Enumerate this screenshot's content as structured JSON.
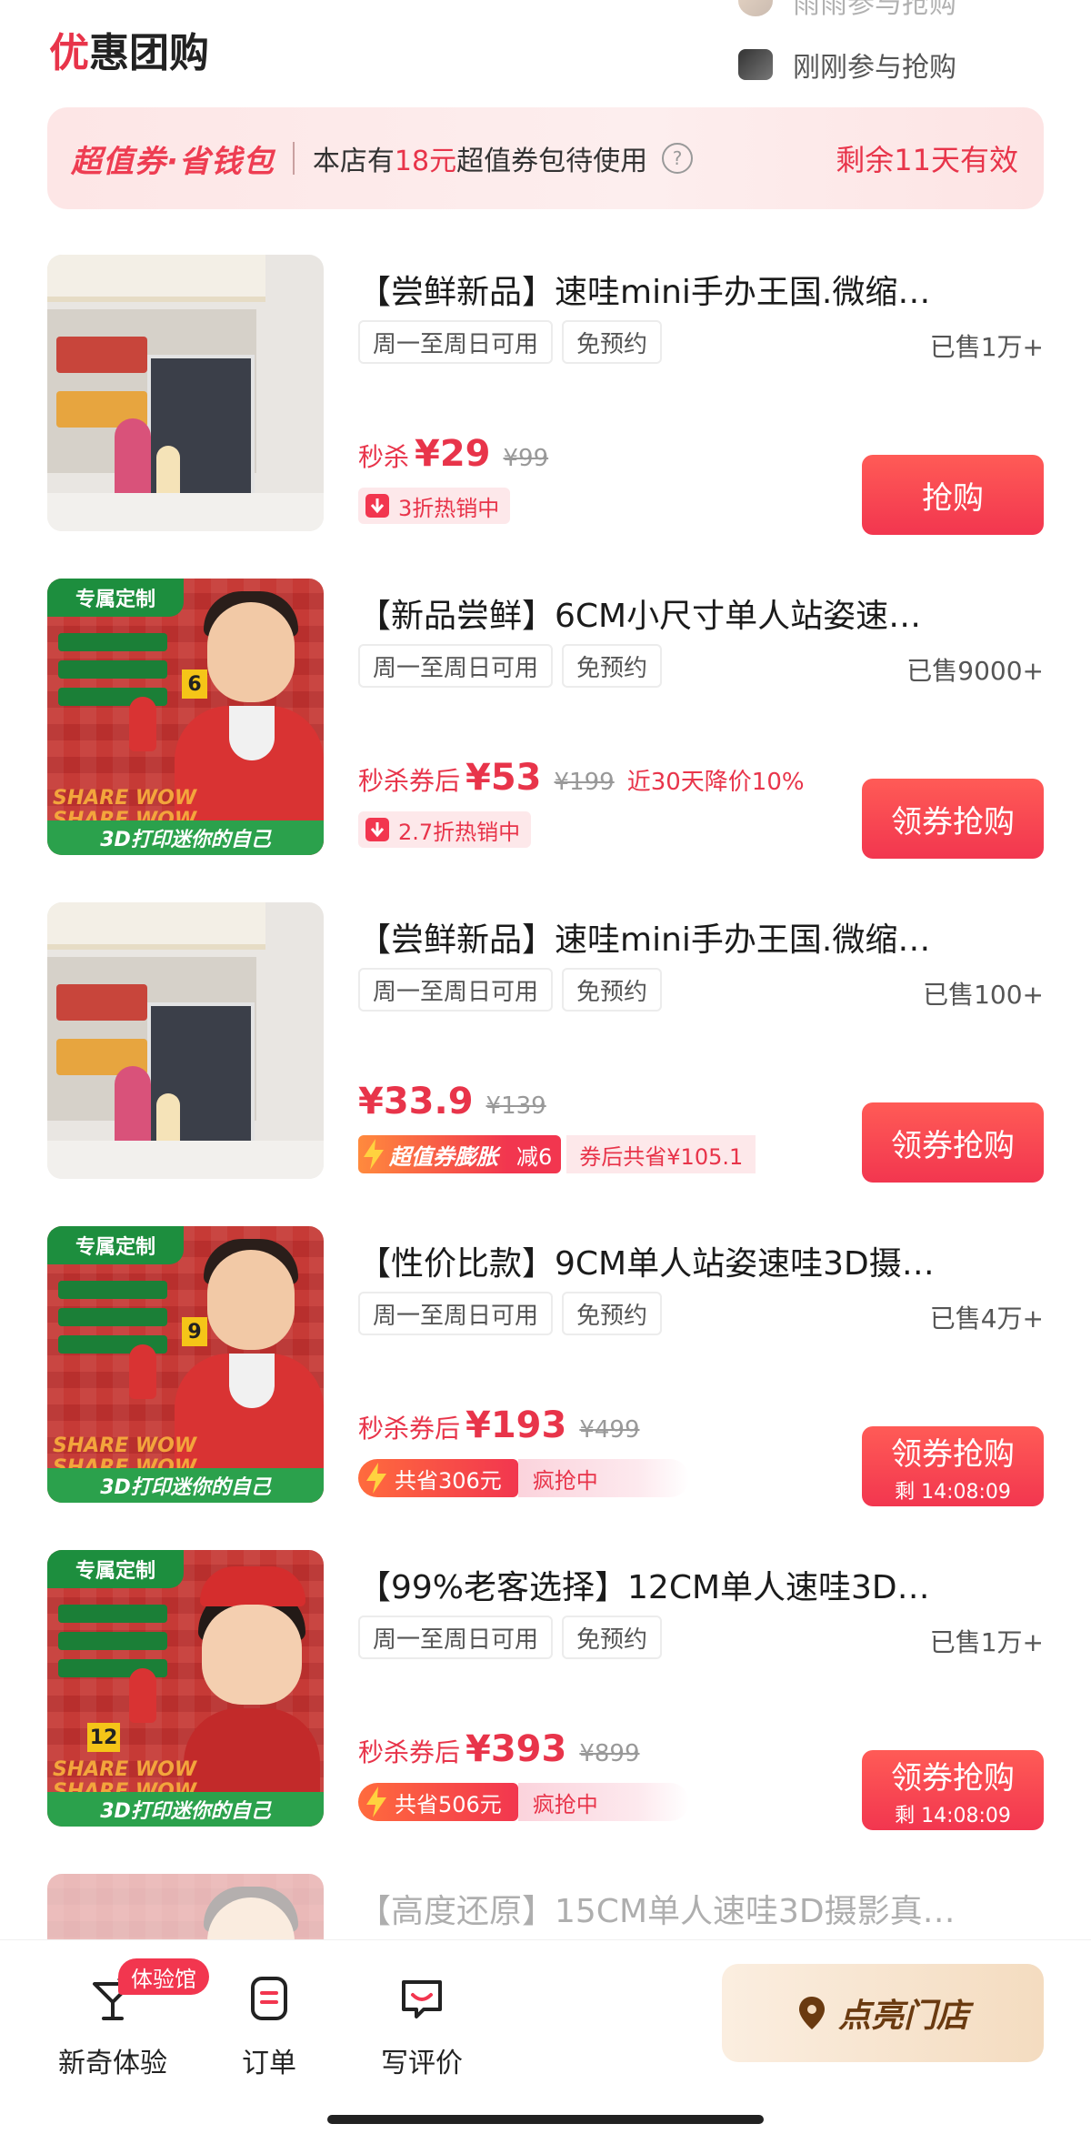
{
  "header": {
    "title_accent": "优",
    "title_rest": "惠团购",
    "rolling_top": "雨雨参与抢购",
    "rolling_live": "刚刚参与抢购"
  },
  "coupon_banner": {
    "brand": "超值券·省钱包",
    "desc_prefix": "本店有",
    "amount": "18元",
    "desc_suffix": "超值券包待使用",
    "expiry": "剩余11天有效"
  },
  "deals": [
    {
      "title": "【尝鲜新品】速哇mini手办王国.微缩…",
      "tags": [
        "周一至周日可用",
        "免预约"
      ],
      "sold": "已售1万+",
      "price_label": "秒杀",
      "price": "¥29",
      "original_price": "¥99",
      "badge": "3折热销中",
      "button": "抢购"
    },
    {
      "title": "【新品尝鲜】6CM小尺寸单人站姿速…",
      "tags": [
        "周一至周日可用",
        "免预约"
      ],
      "sold": "已售9000+",
      "price_label": "秒杀券后",
      "price": "¥53",
      "original_price": "¥199",
      "drop_note": "近30天降价10%",
      "badge": "2.7折热销中",
      "button": "领券抢购",
      "image_tag": "专属定制",
      "image_footer": "3D打印迷你的自己",
      "image_num": "6"
    },
    {
      "title": "【尝鲜新品】速哇mini手办王国.微缩…",
      "tags": [
        "周一至周日可用",
        "免预约"
      ],
      "sold": "已售100+",
      "price": "¥33.9",
      "original_price": "¥139",
      "boost_label": "超值券膨胀",
      "boost_amount": "减6",
      "boost_save": "券后共省¥105.1",
      "button": "领券抢购"
    },
    {
      "title": "【性价比款】9CM单人站姿速哇3D摄…",
      "tags": [
        "周一至周日可用",
        "免预约"
      ],
      "sold": "已售4万+",
      "price_label": "秒杀券后",
      "price": "¥193",
      "original_price": "¥499",
      "save_badge": "共省306元",
      "rush": "疯抢中",
      "button": "领券抢购",
      "countdown": "剩 14:08:09",
      "image_tag": "专属定制",
      "image_footer": "3D打印迷你的自己",
      "image_num": "9"
    },
    {
      "title": "【99%老客选择】12CM单人速哇3D…",
      "tags": [
        "周一至周日可用",
        "免预约"
      ],
      "sold": "已售1万+",
      "price_label": "秒杀券后",
      "price": "¥393",
      "original_price": "¥899",
      "save_badge": "共省506元",
      "rush": "疯抢中",
      "button": "领券抢购",
      "countdown": "剩 14:08:09",
      "image_tag": "专属定制",
      "image_footer": "3D打印迷你的自己",
      "image_num": "12"
    },
    {
      "title": "【高度还原】15CM单人速哇3D摄影真…"
    }
  ],
  "bottom_bar": {
    "experience_badge": "体验馆",
    "experience": "新奇体验",
    "orders": "订单",
    "review": "写评价",
    "light_store": "点亮门店"
  },
  "colors": {
    "accent": "#e8344a",
    "button": "#f2364f",
    "banner_bg": "#fde6e6",
    "light_button": "#f4dcc0"
  }
}
